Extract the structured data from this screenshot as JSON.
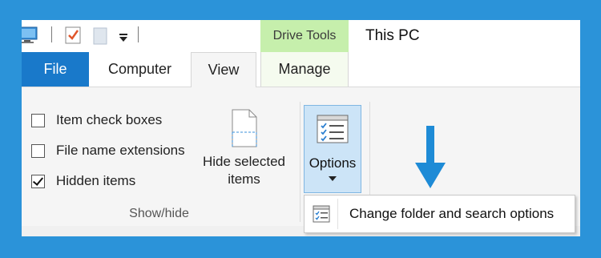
{
  "titlebar": {
    "contextual_tab_group": "Drive Tools",
    "window_title": "This PC",
    "quick_access_icons": [
      "this-pc-icon",
      "properties-icon",
      "new-folder-icon",
      "customize-qat-icon"
    ]
  },
  "tabs": [
    {
      "label": "File"
    },
    {
      "label": "Computer"
    },
    {
      "label": "View"
    },
    {
      "label": "Manage"
    }
  ],
  "ribbon": {
    "show_hide": {
      "checkboxes": [
        {
          "label": "Item check boxes",
          "checked": false
        },
        {
          "label": "File name extensions",
          "checked": false
        },
        {
          "label": "Hidden items",
          "checked": true
        }
      ],
      "hide_selected": {
        "line1": "Hide selected",
        "line2": "items"
      },
      "group_label": "Show/hide"
    },
    "options": {
      "label": "Options"
    }
  },
  "menu": {
    "item_label": "Change folder and search options"
  },
  "colors": {
    "background": "#2b93d9",
    "file_tab": "#1979ca",
    "drive_tools": "#c6efac",
    "options_highlight": "#cce4f7",
    "arrow": "#1e8bd6"
  }
}
